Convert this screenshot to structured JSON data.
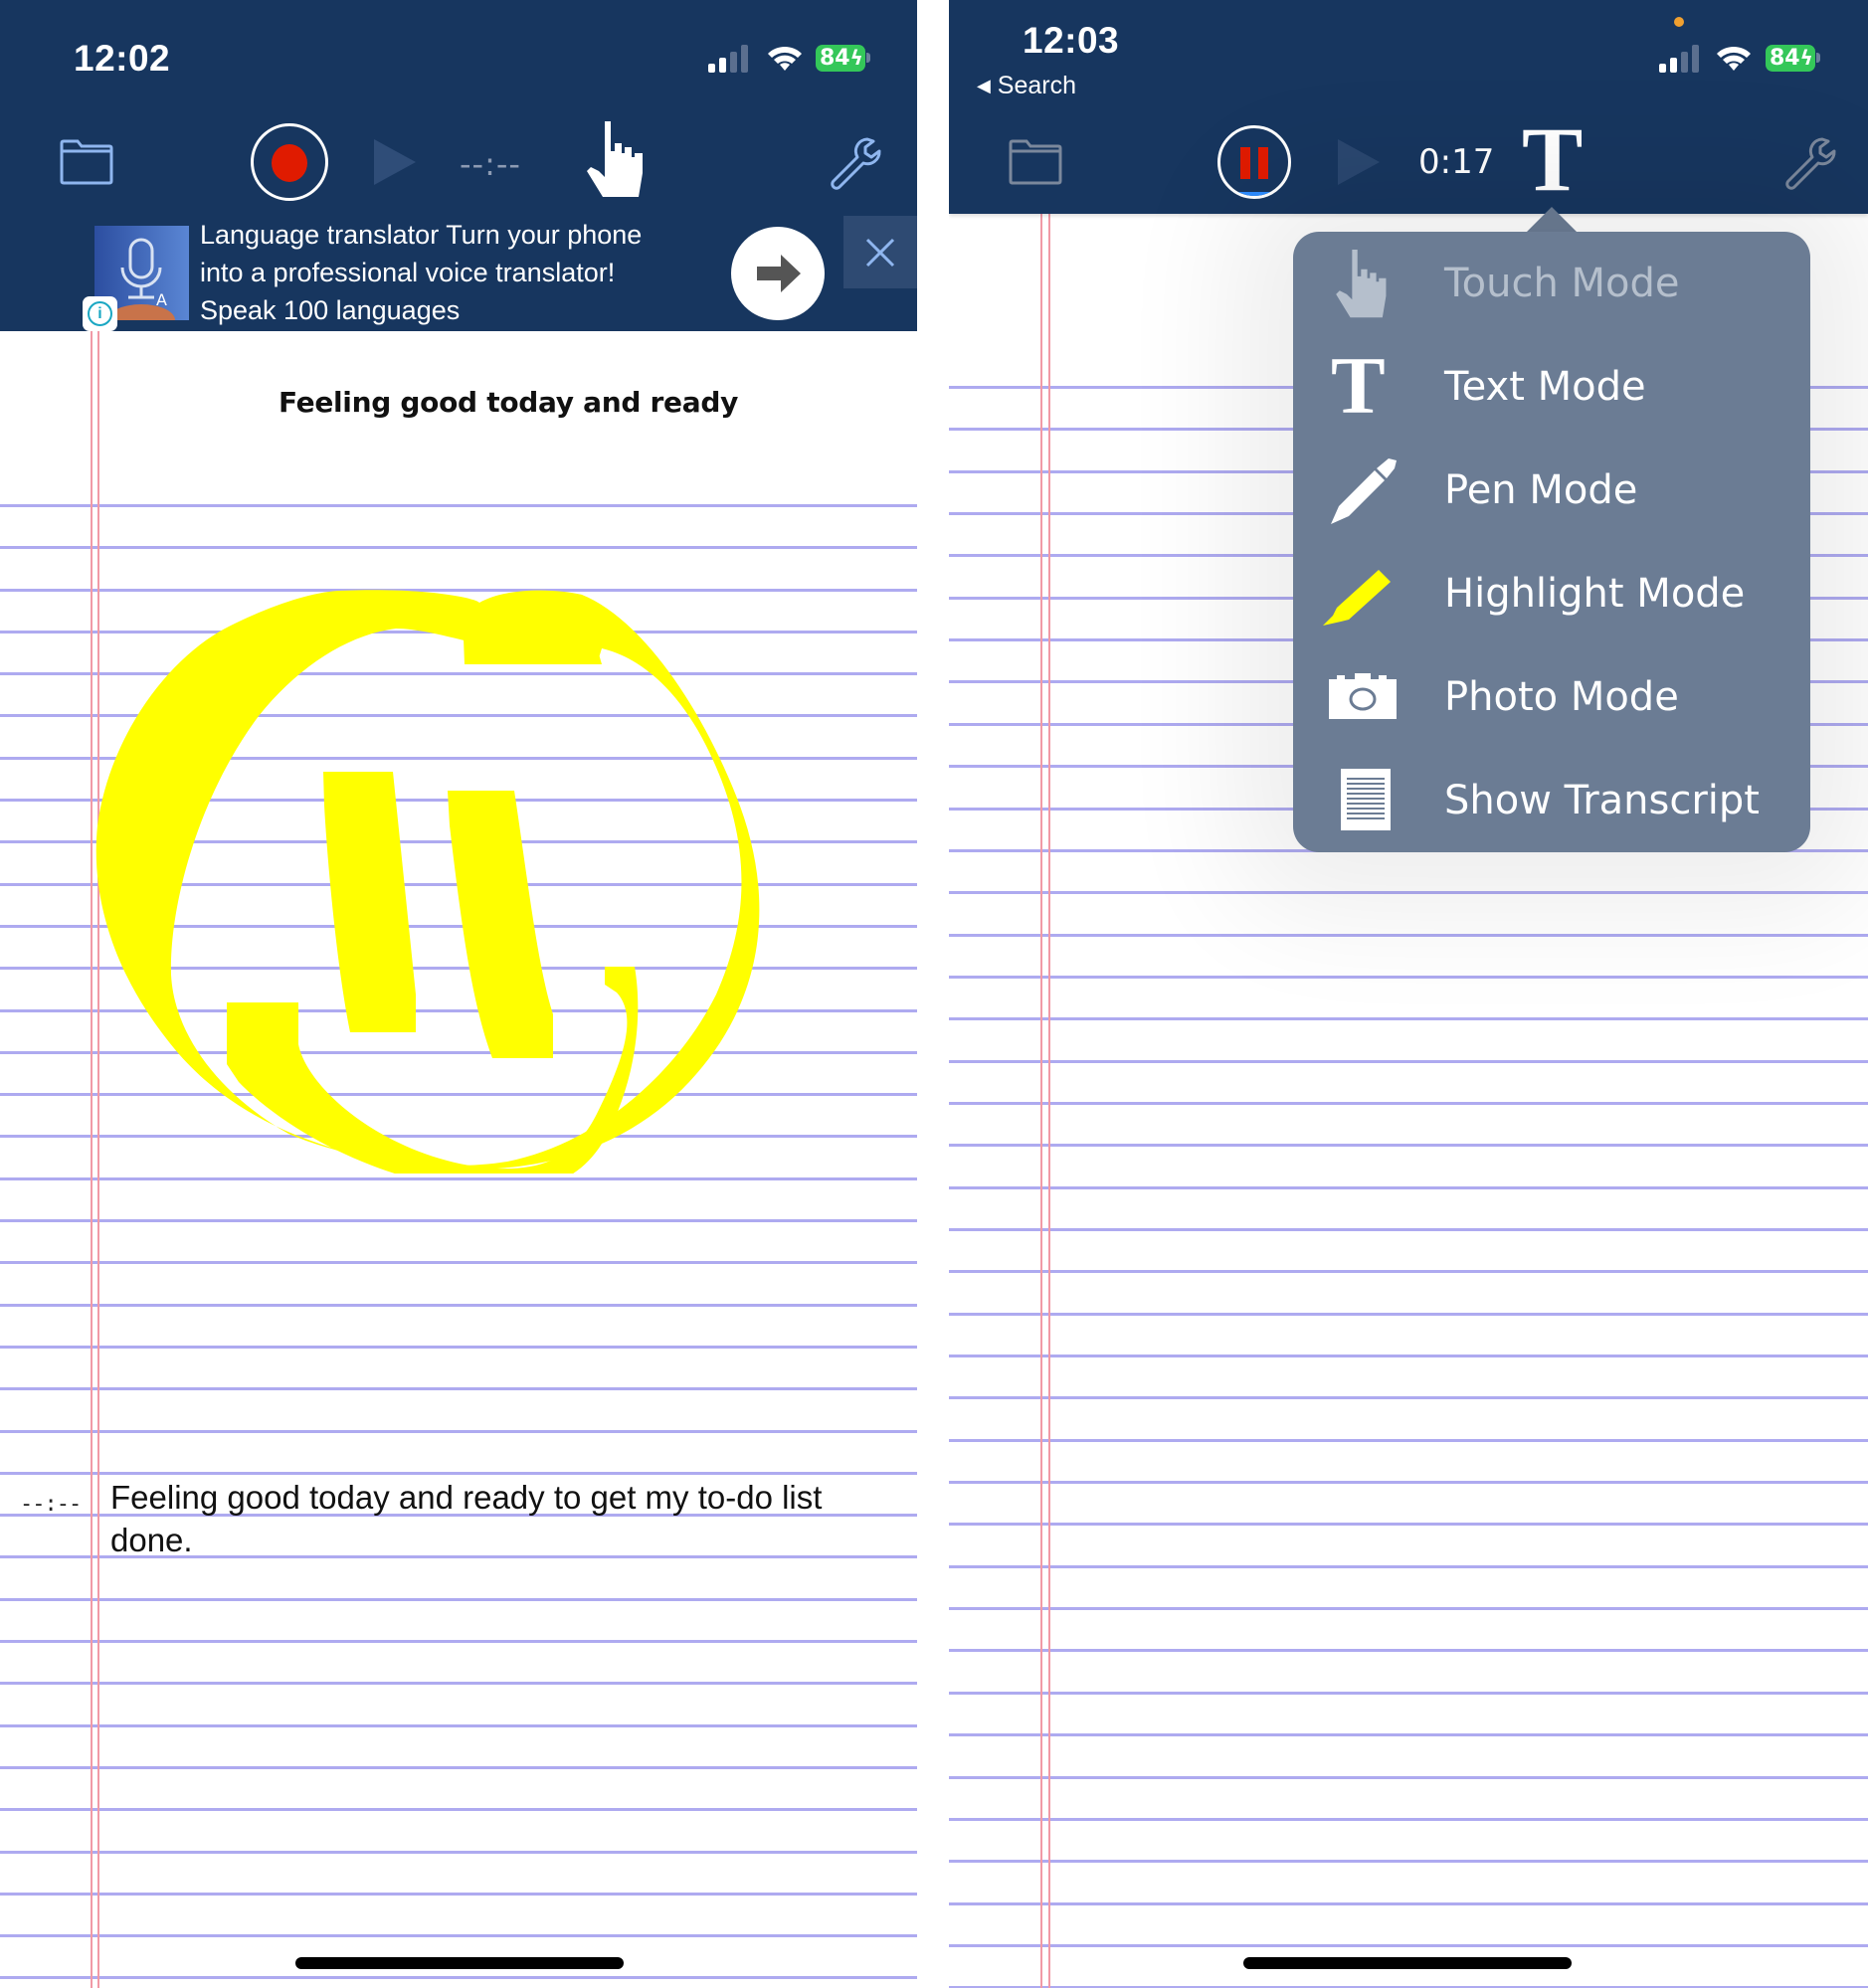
{
  "left_screen": {
    "status_bar": {
      "time": "12:02",
      "battery_percent": "84",
      "signal_bars_active": 2,
      "signal_bars_total": 4
    },
    "toolbar": {
      "folder_icon": "folder-icon",
      "record_icon": "record-icon",
      "play_icon": "play-icon",
      "timer": "--:--",
      "mode_icon": "touch-hand-icon",
      "settings_icon": "wrench-icon"
    },
    "ad": {
      "text_line1": "Language translator Turn your phone",
      "text_line2": "into a professional voice translator!",
      "text_line3": "Speak 100 languages",
      "info_icon": "info-icon",
      "go_icon": "arrow-right-icon",
      "close_icon": "close-icon"
    },
    "note": {
      "heading": "Feeling good today and ready",
      "transcript_timestamp": "--:--",
      "transcript_text": "Feeling good today and ready to get my to-do list done.",
      "drawing": "yellow-highlighter-smiley-face"
    }
  },
  "right_screen": {
    "status_bar": {
      "time": "12:03",
      "back_label": "Search",
      "battery_percent": "84",
      "signal_bars_active": 2,
      "signal_bars_total": 4
    },
    "toolbar": {
      "folder_icon": "folder-icon",
      "pause_icon": "pause-icon",
      "play_icon": "play-icon",
      "timer": "0:17",
      "mode_icon": "text-mode-icon",
      "mode_glyph": "T",
      "settings_icon": "wrench-icon"
    },
    "mode_menu": {
      "items": [
        {
          "label": "Touch Mode",
          "icon": "touch-hand-icon",
          "disabled": true
        },
        {
          "label": "Text Mode",
          "icon": "text-t-icon",
          "glyph": "T",
          "disabled": false
        },
        {
          "label": "Pen Mode",
          "icon": "pen-icon",
          "disabled": false
        },
        {
          "label": "Highlight Mode",
          "icon": "highlighter-icon",
          "disabled": false
        },
        {
          "label": "Photo Mode",
          "icon": "camera-icon",
          "disabled": false
        },
        {
          "label": "Show Transcript",
          "icon": "transcript-document-icon",
          "disabled": false
        }
      ]
    }
  },
  "colors": {
    "header_bg": "#17365f",
    "record_red": "#e01b00",
    "rule_line": "#aeaaf0",
    "margin_line": "#f19aa6",
    "highlighter_yellow": "#ffff00",
    "popover_bg": "#6b7c94",
    "battery_green": "#34c759"
  }
}
